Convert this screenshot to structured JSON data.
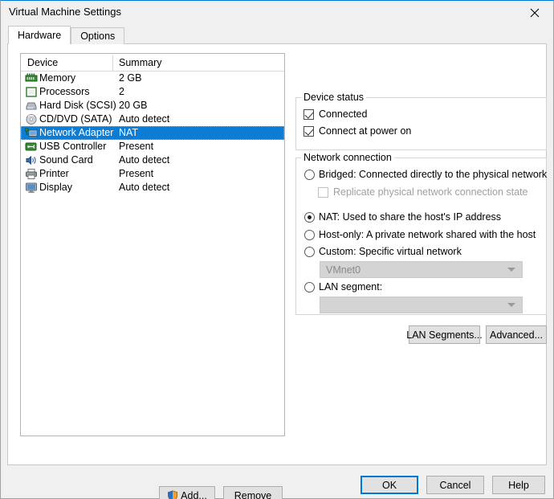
{
  "window": {
    "title": "Virtual Machine Settings",
    "close_icon": "close-icon",
    "accent_color": "#0078d7"
  },
  "tabs": [
    {
      "label": "Hardware",
      "active": true
    },
    {
      "label": "Options",
      "active": false
    }
  ],
  "device_list": {
    "columns": [
      "Device",
      "Summary"
    ],
    "rows": [
      {
        "icon": "memory-icon",
        "name": "Memory",
        "summary": "2 GB",
        "selected": false
      },
      {
        "icon": "processor-icon",
        "name": "Processors",
        "summary": "2",
        "selected": false
      },
      {
        "icon": "hard-disk-icon",
        "name": "Hard Disk (SCSI)",
        "summary": "20 GB",
        "selected": false
      },
      {
        "icon": "cd-dvd-icon",
        "name": "CD/DVD (SATA)",
        "summary": "Auto detect",
        "selected": false
      },
      {
        "icon": "network-adapter-icon",
        "name": "Network Adapter",
        "summary": "NAT",
        "selected": true
      },
      {
        "icon": "usb-controller-icon",
        "name": "USB Controller",
        "summary": "Present",
        "selected": false
      },
      {
        "icon": "sound-card-icon",
        "name": "Sound Card",
        "summary": "Auto detect",
        "selected": false
      },
      {
        "icon": "printer-icon",
        "name": "Printer",
        "summary": "Present",
        "selected": false
      },
      {
        "icon": "display-icon",
        "name": "Display",
        "summary": "Auto detect",
        "selected": false
      }
    ],
    "selection_color": "#0c7cd5"
  },
  "list_buttons": {
    "add_label": "Add...",
    "add_icon": "uac-shield-icon",
    "remove_label": "Remove"
  },
  "device_status": {
    "legend": "Device status",
    "options": [
      {
        "label": "Connected",
        "checked": true
      },
      {
        "label": "Connect at power on",
        "checked": true
      }
    ]
  },
  "network_connection": {
    "legend": "Network connection",
    "options": [
      {
        "label": "Bridged: Connected directly to the physical network",
        "selected": false
      },
      {
        "label": "NAT: Used to share the host's IP address",
        "selected": true
      },
      {
        "label": "Host-only: A private network shared with the host",
        "selected": false
      },
      {
        "label": "Custom: Specific virtual network",
        "selected": false
      },
      {
        "label": "LAN segment:",
        "selected": false
      }
    ],
    "replicate_checkbox": {
      "label": "Replicate physical network connection state",
      "checked": false,
      "disabled": true
    },
    "custom_combo": {
      "value": "VMnet0",
      "disabled": true
    },
    "lan_segment_combo": {
      "value": "",
      "disabled": true
    }
  },
  "network_buttons": {
    "lan_segments_label": "LAN Segments...",
    "advanced_label": "Advanced..."
  },
  "footer": {
    "ok_label": "OK",
    "cancel_label": "Cancel",
    "help_label": "Help"
  }
}
